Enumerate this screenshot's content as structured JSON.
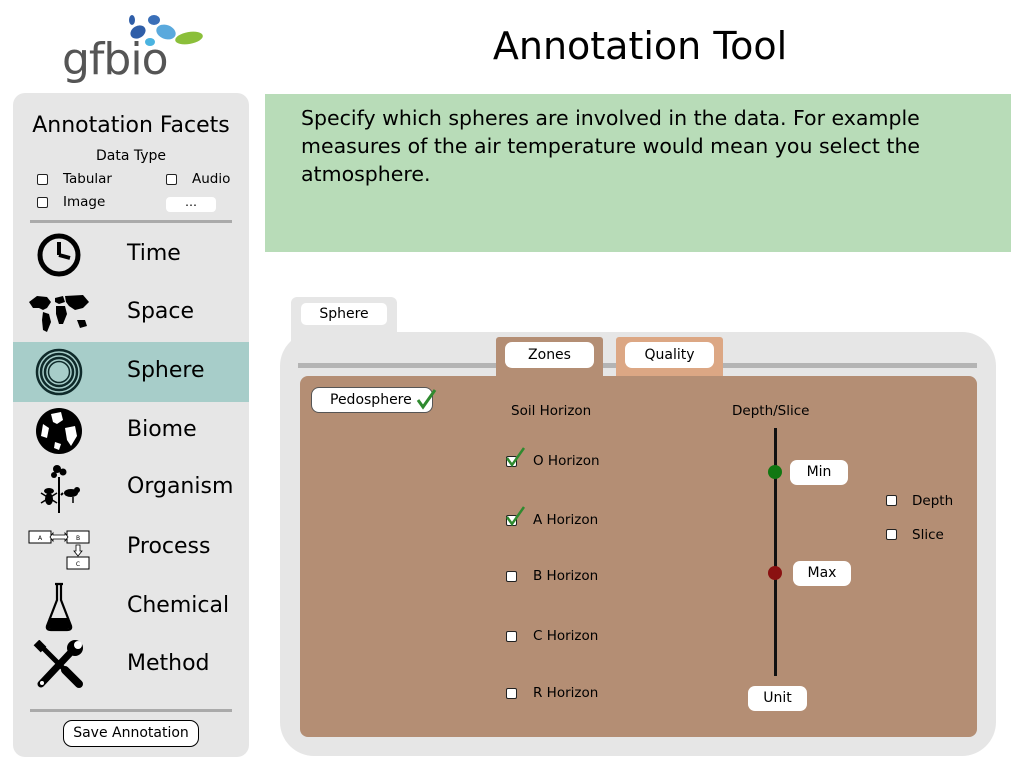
{
  "header": {
    "logo_text": "gfbio",
    "title": "Annotation Tool"
  },
  "sidebar": {
    "title": "Annotation Facets",
    "data_type": {
      "label": "Data Type",
      "options": [
        "Tabular",
        "Audio",
        "Image"
      ],
      "more_label": "…"
    },
    "items": [
      {
        "label": "Time",
        "icon": "clock-icon"
      },
      {
        "label": "Space",
        "icon": "world-map-icon"
      },
      {
        "label": "Sphere",
        "icon": "concentric-rings-icon",
        "active": true
      },
      {
        "label": "Biome",
        "icon": "globe-icon"
      },
      {
        "label": "Organism",
        "icon": "organism-icon"
      },
      {
        "label": "Process",
        "icon": "process-flow-icon"
      },
      {
        "label": "Chemical",
        "icon": "flask-icon"
      },
      {
        "label": "Method",
        "icon": "tools-icon"
      }
    ],
    "save_label": "Save Annotation"
  },
  "info": {
    "text": "Specify which spheres are involved in the data. For example measures of the air temperature would mean you select the atmosphere."
  },
  "panel": {
    "tab_label": "Sphere",
    "subtabs": [
      "Zones",
      "Quality"
    ],
    "selected_sphere": "Pedosphere",
    "soil_horizon": {
      "label": "Soil Horizon",
      "items": [
        {
          "label": "O Horizon",
          "checked": true
        },
        {
          "label": "A Horizon",
          "checked": true
        },
        {
          "label": "B Horizon",
          "checked": false
        },
        {
          "label": "C Horizon",
          "checked": false
        },
        {
          "label": "R Horizon",
          "checked": false
        }
      ]
    },
    "depth_slice": {
      "label": "Depth/Slice",
      "min_label": "Min",
      "max_label": "Max",
      "unit_label": "Unit",
      "options": [
        "Depth",
        "Slice"
      ]
    }
  },
  "colors": {
    "info_bg": "#b8dcb8",
    "active_item_bg": "#a7cdc9",
    "zones_bg": "#b48e74",
    "quality_tab_bg": "#dca784",
    "check_green": "#2f8a2f",
    "min_dot": "#117711",
    "max_dot": "#8a1111"
  }
}
